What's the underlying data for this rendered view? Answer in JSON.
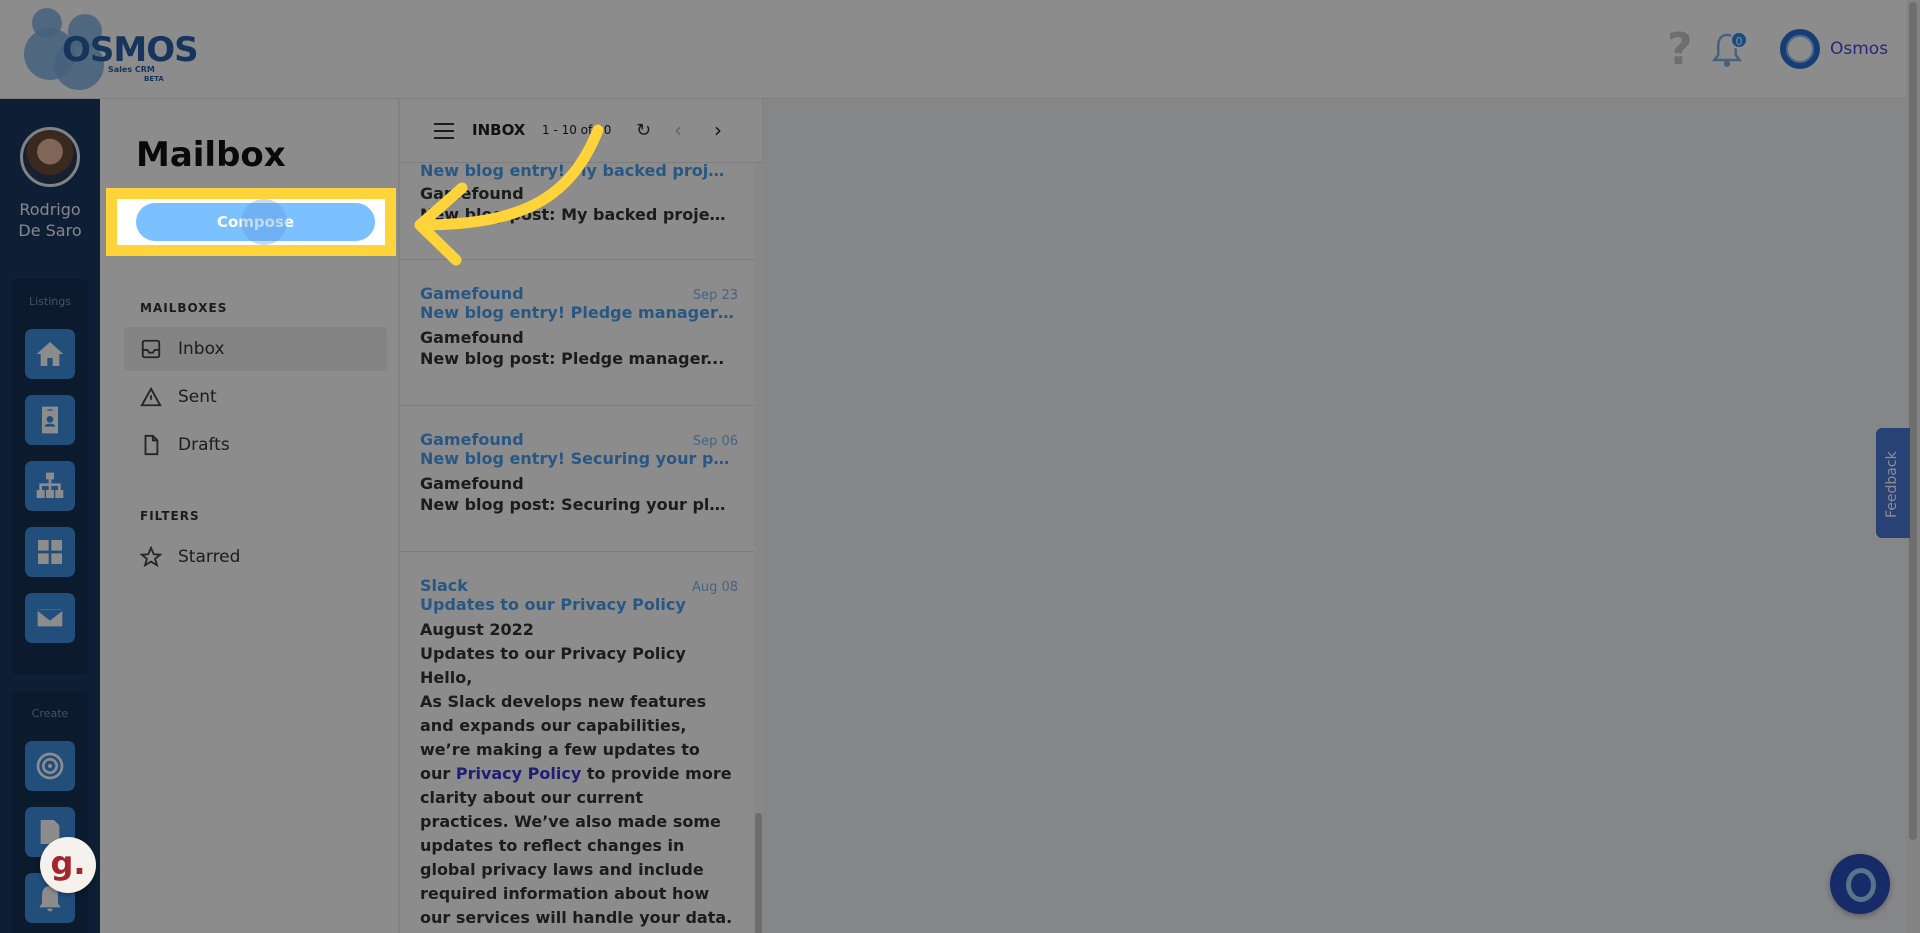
{
  "header": {
    "logo_text": "OSMOS",
    "logo_subtitle": "Sales CRM",
    "logo_badge": "BETA",
    "help_icon": "?",
    "notification_count": "0",
    "user_name": "Osmos"
  },
  "leftnav": {
    "profile_name_line1": "Rodrigo",
    "profile_name_line2": "De Saro",
    "listings_label": "Listings",
    "create_label": "Create",
    "listing_icons": [
      "home-icon",
      "contact-card-icon",
      "org-chart-icon",
      "grid-icon",
      "mail-icon"
    ],
    "create_icons": [
      "target-icon",
      "document-icon",
      "bell-icon"
    ]
  },
  "mailbox": {
    "title": "Mailbox",
    "compose_label": "Compose",
    "mailboxes_label": "MAILBOXES",
    "filters_label": "FILTERS",
    "items": [
      {
        "label": "Inbox"
      },
      {
        "label": "Sent"
      },
      {
        "label": "Drafts"
      }
    ],
    "filters": [
      {
        "label": "Starred"
      }
    ]
  },
  "message_list": {
    "folder_label": "INBOX",
    "page_count": "1 - 10 of 30",
    "messages": [
      {
        "sender": "",
        "date": "",
        "subject": "New blog entry! My backed project a...",
        "from": "Gamefound",
        "preview": "New blog post: My backed project an..."
      },
      {
        "sender": "Gamefound",
        "date": "Sep 23",
        "subject": "New blog entry! Pledge manager with...",
        "from": "Gamefound",
        "preview": "New blog post: Pledge manager..."
      },
      {
        "sender": "Gamefound",
        "date": "Sep 06",
        "subject": "New blog entry! Securing your pledge...",
        "from": "Gamefound",
        "preview": "New blog post: Securing your pledge i..."
      },
      {
        "sender": "Slack",
        "date": "Aug 08",
        "subject": "Updates to our Privacy Policy",
        "body_line1": "August 2022",
        "body_line2": "Updates to our Privacy Policy",
        "body_line3": "Hello,",
        "body_before_link": "As Slack develops new features and expands our capabilities, we’re making a few updates to our ",
        "body_link": "Privacy Policy",
        "body_after_link": " to provide more clarity about our current practices. We’ve also made some updates to reflect changes in global privacy laws and include required information about how our services will handle your data. Want to learn more? Great! There’s a"
      }
    ]
  },
  "widgets": {
    "feedback_label": "Feedback",
    "g_badge": "g."
  },
  "colors": {
    "highlight": "#ffd43b",
    "accent": "#4a9ff0",
    "nav_bg": "#1b3760"
  }
}
